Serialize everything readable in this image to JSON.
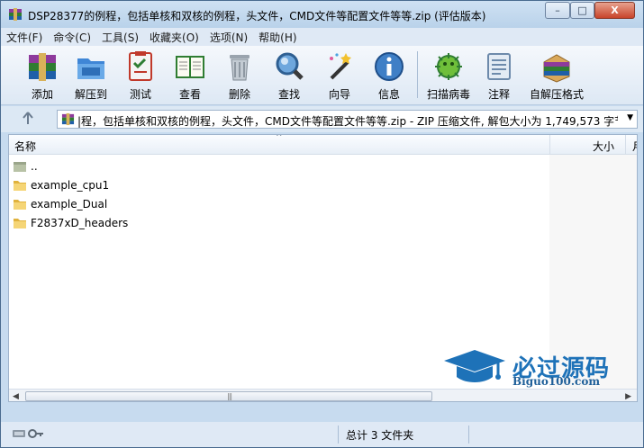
{
  "window": {
    "title": "DSP28377的例程，包括单核和双核的例程，头文件，CMD文件等配置文件等等.zip (评估版本)",
    "controls": {
      "minimize": "–",
      "maximize": "□",
      "close": "X"
    }
  },
  "menubar": {
    "items": [
      "文件(F)",
      "命令(C)",
      "工具(S)",
      "收藏夹(O)",
      "选项(N)",
      "帮助(H)"
    ]
  },
  "toolbar": {
    "tools": [
      {
        "label": "添加",
        "icon": "add-archive-icon"
      },
      {
        "label": "解压到",
        "icon": "extract-to-icon"
      },
      {
        "label": "测试",
        "icon": "test-icon"
      },
      {
        "label": "查看",
        "icon": "view-book-icon"
      },
      {
        "label": "删除",
        "icon": "trash-icon"
      },
      {
        "label": "查找",
        "icon": "magnifier-icon"
      },
      {
        "label": "向导",
        "icon": "wizard-icon"
      },
      {
        "label": "信息",
        "icon": "info-icon"
      },
      {
        "label": "扫描病毒",
        "icon": "virus-scan-icon"
      },
      {
        "label": "注释",
        "icon": "comment-icon"
      },
      {
        "label": "自解压格式",
        "icon": "sfx-icon"
      }
    ]
  },
  "addressbar": {
    "up_symbol": "🡑",
    "path": "|程，包括单核和双核的例程，头文件，CMD文件等配置文件等等.zip - ZIP 压缩文件, 解包大小为 1,749,573 字节",
    "dropdown_symbol": "▼"
  },
  "filelist": {
    "columns": {
      "name": "名称",
      "size": "大小",
      "next": "月"
    },
    "sort_symbol": "^",
    "rows": [
      {
        "name": ".."
      },
      {
        "name": "example_cpu1"
      },
      {
        "name": "example_Dual"
      },
      {
        "name": "F2837xD_headers"
      }
    ]
  },
  "scrollbar": {
    "left": "◀",
    "right": "▶",
    "grip": "|||"
  },
  "statusbar": {
    "text": "总计 3 文件夹"
  },
  "watermark": {
    "text": "必过源码",
    "url": "Biguo100.com"
  },
  "colors": {
    "window_frame": "#c7dbef",
    "accent_blue": "#1e72b8",
    "close_red": "#c8442a"
  }
}
